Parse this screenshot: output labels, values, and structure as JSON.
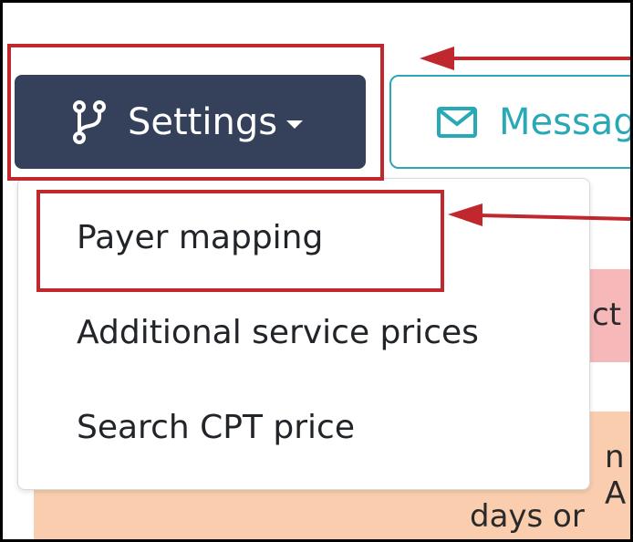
{
  "toolbar": {
    "settings_label": "Settings",
    "message_label": "Messag"
  },
  "dropdown": {
    "items": [
      {
        "label": "Payer mapping"
      },
      {
        "label": "Additional service prices"
      },
      {
        "label": "Search CPT price"
      }
    ]
  },
  "background": {
    "pink_text": "ct",
    "peach_text_1": "n A",
    "peach_text_2": "days or"
  },
  "colors": {
    "settings_bg": "#35415b",
    "message_accent": "#29a9b5",
    "annotation_red": "#c0282d",
    "pink_row": "#f6b8b8",
    "peach_row": "#f9cdae"
  },
  "icons": {
    "settings": "code-branch-icon",
    "message": "envelope-icon",
    "caret": "caret-down-icon"
  }
}
